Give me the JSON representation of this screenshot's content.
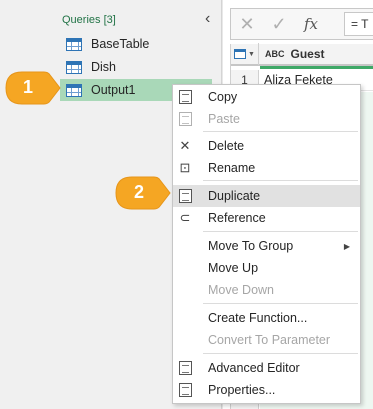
{
  "queries_panel": {
    "header": "Queries [3]",
    "collapse_glyph": "‹",
    "items": [
      {
        "label": "BaseTable"
      },
      {
        "label": "Dish"
      },
      {
        "label": "Output1",
        "selected": true
      }
    ]
  },
  "formula_bar": {
    "cancel_glyph": "✕",
    "commit_glyph": "✓",
    "fx_glyph": "fx",
    "formula_text": "= T"
  },
  "grid": {
    "type_icon": "ABC",
    "column_header": "Guest",
    "rows": [
      {
        "num": "1",
        "value": "Aliza Fekete"
      }
    ]
  },
  "context_menu": {
    "items": [
      {
        "label": "Copy",
        "icon": "copy-icon",
        "disabled": false
      },
      {
        "label": "Paste",
        "icon": "paste-icon",
        "disabled": true
      },
      {
        "label": "Delete",
        "icon": "delete-icon",
        "disabled": false
      },
      {
        "label": "Rename",
        "icon": "rename-icon",
        "disabled": false
      },
      {
        "label": "Duplicate",
        "icon": "duplicate-icon",
        "disabled": false,
        "highlighted": true
      },
      {
        "label": "Reference",
        "icon": "reference-icon",
        "disabled": false
      },
      {
        "label": "Move To Group",
        "icon": "",
        "disabled": false,
        "submenu": true
      },
      {
        "label": "Move Up",
        "icon": "",
        "disabled": false
      },
      {
        "label": "Move Down",
        "icon": "",
        "disabled": true
      },
      {
        "label": "Create Function...",
        "icon": "",
        "disabled": false
      },
      {
        "label": "Convert To Parameter",
        "icon": "",
        "disabled": true
      },
      {
        "label": "Advanced Editor",
        "icon": "advanced-editor-icon",
        "disabled": false
      },
      {
        "label": "Properties...",
        "icon": "properties-icon",
        "disabled": false
      }
    ]
  },
  "callouts": [
    {
      "number": "1"
    },
    {
      "number": "2"
    }
  ],
  "colors": {
    "accent_green": "#217346",
    "selected_bg": "#a9d8b8",
    "callout_orange": "#f5a623"
  }
}
